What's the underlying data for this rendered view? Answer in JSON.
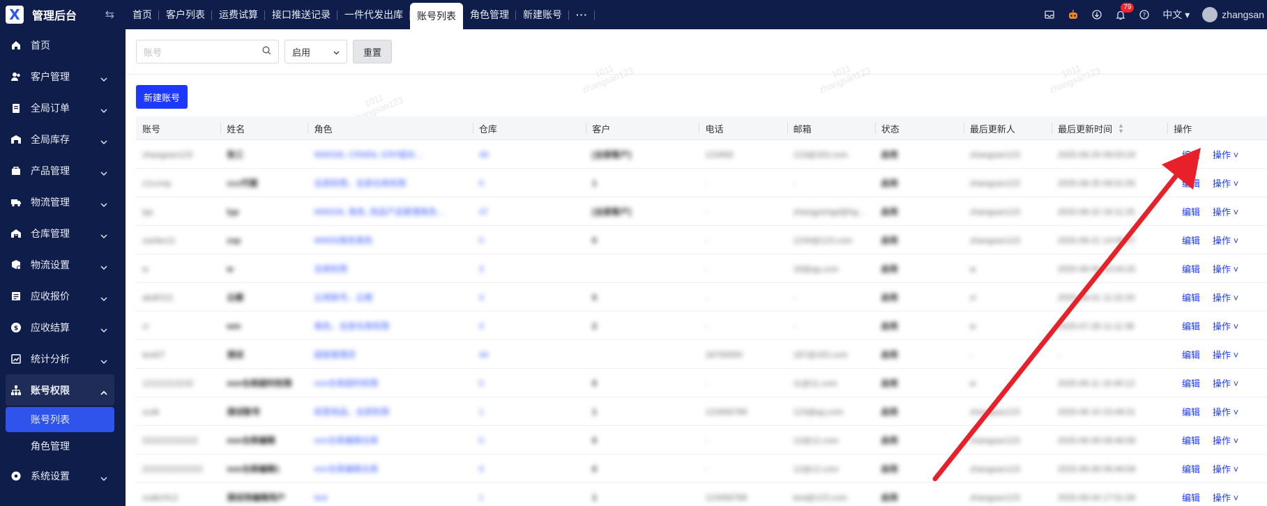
{
  "brand": {
    "name": "管理后台",
    "logo_letter": "X"
  },
  "tabs": [
    {
      "label": "首页"
    },
    {
      "label": "客户列表"
    },
    {
      "label": "运费试算"
    },
    {
      "label": "接口推送记录"
    },
    {
      "label": "一件代发出库"
    },
    {
      "label": "账号列表",
      "active": true
    },
    {
      "label": "角色管理"
    },
    {
      "label": "新建账号"
    },
    {
      "label": "···"
    }
  ],
  "header": {
    "notification_count": "79",
    "language": "中文",
    "username": "zhangsan"
  },
  "sidebar": {
    "items": [
      {
        "label": "首页",
        "icon": "home-icon"
      },
      {
        "label": "客户管理",
        "icon": "customers-icon"
      },
      {
        "label": "全局订单",
        "icon": "orders-icon"
      },
      {
        "label": "全局库存",
        "icon": "inventory-icon"
      },
      {
        "label": "产品管理",
        "icon": "product-icon"
      },
      {
        "label": "物流管理",
        "icon": "truck-icon"
      },
      {
        "label": "仓库管理",
        "icon": "warehouse-icon"
      },
      {
        "label": "物流设置",
        "icon": "logistics-settings-icon"
      },
      {
        "label": "应收报价",
        "icon": "quote-icon"
      },
      {
        "label": "应收结算",
        "icon": "settlement-icon"
      },
      {
        "label": "统计分析",
        "icon": "chart-icon"
      },
      {
        "label": "账号权限",
        "icon": "org-icon",
        "open": true
      }
    ],
    "sub_items": [
      {
        "label": "账号列表",
        "active": true
      },
      {
        "label": "角色管理"
      }
    ],
    "system_settings": "系统设置"
  },
  "filters": {
    "account_placeholder": "账号",
    "status_value": "启用",
    "reset_label": "重置"
  },
  "new_account_label": "新建账号",
  "table": {
    "headers": [
      "账号",
      "姓名",
      "角色",
      "仓库",
      "客户",
      "电话",
      "邮箱",
      "状态",
      "最后更新人",
      "最后更新时间",
      "操作"
    ],
    "rows": [
      [
        "zhangsan123",
        "张三",
        "WMS06, CRM56, ERP超长…",
        "49",
        "[全部客户]",
        "123456",
        "123@163.com",
        "启用",
        "zhangsan123",
        "2025-08-25 09:03:24"
      ],
      [
        "z1ccmp",
        "ccc代理",
        "全部权限，全部仓库权限",
        "0",
        "1",
        "-",
        "-",
        "启用",
        "zhangsan123",
        "2025-08-25 09:01:55"
      ],
      [
        "lyp",
        "lyp",
        "WMS06, 角色, 商品产品管理角色…",
        "47",
        "[全部客户]",
        "-",
        "zhangyizhgd@hg…",
        "启用",
        "zhangsan123",
        "2025-08-22 16:11:25"
      ],
      [
        "zasfan11",
        "zxp",
        "WMS6角色角色",
        "0",
        "0",
        "-",
        "1234@123.com",
        "启用",
        "zhangsan123",
        "2025-08-21 14:06:07"
      ],
      [
        "w",
        "w",
        "全部权限",
        "3",
        "",
        "-",
        "18@qq.com",
        "启用",
        "w",
        "2025-08-05 10:04:20"
      ],
      [
        "abd0111",
        "云楼",
        "云用账号，云楼",
        "4",
        "0",
        "-",
        "-",
        "启用",
        "cl",
        "2025-08-01 11:22:20"
      ],
      [
        "cl",
        "wm",
        "角色，全部仓库权限",
        "4",
        "2",
        "-",
        "-",
        "启用",
        "w",
        "2025-07-28 11:11:38"
      ],
      [
        "test07",
        "测试",
        "超级管理员",
        "44",
        "",
        "18700000",
        "187@163.com",
        "启用",
        "-",
        "-"
      ],
      [
        "12121212232",
        "mm仓库超时权限",
        "mm仓库超时权限",
        "0",
        "0",
        "-",
        "11@11.com",
        "启用",
        "w",
        "2025-06-11 15:40:12"
      ],
      [
        "scdk",
        "测试账号",
        "经营商品，全部权限",
        "1",
        "1",
        "123456789",
        "123@qq.com",
        "启用",
        "zhangsan123",
        "2025-06-10 23:49:31"
      ],
      [
        "222222222222",
        "mm仓库编辑",
        "mm仓库编辑仓库",
        "0",
        "0",
        "-",
        "12@12.com",
        "启用",
        "zhangsan123",
        "2025-06-09 09:48:58"
      ],
      [
        "2222222222222",
        "mm仓库编辑1",
        "mm仓库编辑仓库",
        "0",
        "0",
        "-",
        "12@12.com",
        "启用",
        "zhangsan123",
        "2025-06-09 09:49:59"
      ],
      [
        "zsdk2412",
        "测试用编辑用户",
        "test",
        "1",
        "1",
        "123456789",
        "test@123.com",
        "启用",
        "zhangsan123",
        "2025-06-04 17:51:56"
      ]
    ],
    "edit_label": "编辑",
    "ops_label": "操作"
  },
  "watermark": {
    "line1": "1011",
    "line2": "zhangsan123"
  },
  "colors": {
    "sidebar_bg": "#0f1d4a",
    "primary": "#1d39ff",
    "arrow": "#e8202a"
  }
}
